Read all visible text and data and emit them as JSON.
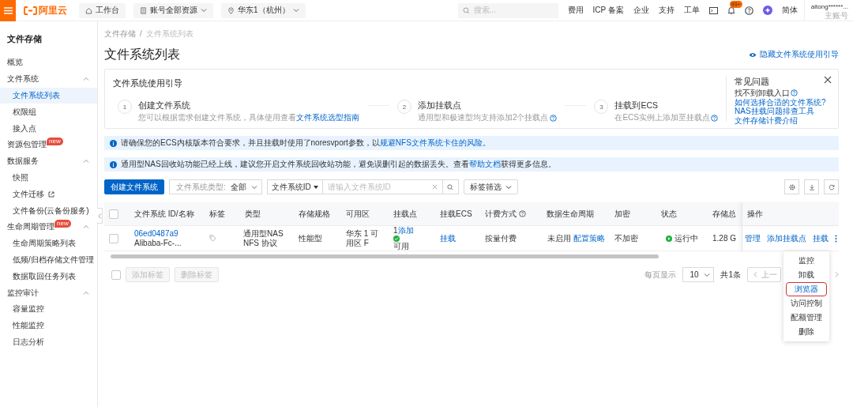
{
  "topbar": {
    "logo": "阿里云",
    "nav": [
      {
        "label": "工作台",
        "kind": "home"
      },
      {
        "label": "账号全部资源",
        "kind": "resource"
      },
      {
        "label": "华东1（杭州）",
        "kind": "region"
      }
    ],
    "search": {
      "placeholder": "搜索..."
    },
    "links": [
      "费用",
      "ICP 备案",
      "企业",
      "支持",
      "工单"
    ],
    "notification_badge": "99+",
    "language": "简体",
    "user": {
      "name": "aitong******...",
      "role": "主账号"
    }
  },
  "sidebar": {
    "title": "文件存储",
    "items": [
      {
        "label": "概览",
        "selected": false
      },
      {
        "label": "文件系统",
        "selected": false,
        "expanded": true,
        "children": [
          {
            "label": "文件系统列表",
            "selected": true
          },
          {
            "label": "权限组",
            "selected": false
          },
          {
            "label": "接入点",
            "selected": false
          }
        ]
      },
      {
        "label": "资源包管理",
        "badge": "new",
        "selected": false
      },
      {
        "label": "数据服务",
        "selected": false,
        "expanded": true,
        "children": [
          {
            "label": "快照",
            "selected": false,
            "external": false
          },
          {
            "label": "文件迁移",
            "selected": false,
            "external": true
          },
          {
            "label": "文件备份(云备份服务)",
            "selected": false,
            "external": false
          }
        ]
      },
      {
        "label": "生命周期管理",
        "badge": "new",
        "selected": false,
        "expanded": true,
        "children": [
          {
            "label": "生命周期策略列表",
            "selected": false
          },
          {
            "label": "低频/归档存储文件管理",
            "selected": false
          },
          {
            "label": "数据取回任务列表",
            "selected": false
          }
        ]
      },
      {
        "label": "监控审计",
        "selected": false,
        "expanded": true,
        "children": [
          {
            "label": "容量监控",
            "selected": false
          },
          {
            "label": "性能监控",
            "selected": false
          },
          {
            "label": "日志分析",
            "selected": false
          }
        ]
      }
    ]
  },
  "page": {
    "breadcrumb": [
      "文件存储",
      "文件系统列表"
    ],
    "breadcrumb_separator": "/",
    "title": "文件系统列表",
    "guide_toggle": "隐藏文件系统使用引导"
  },
  "guide": {
    "title": "文件系统使用引导",
    "steps": [
      {
        "number": "1",
        "title": "创建文件系统",
        "desc": "您可以根据需求创建文件系统，具体使用查看",
        "link": "文件系统选型指南",
        "help": false
      },
      {
        "number": "2",
        "title": "添加挂载点",
        "desc": "通用型和极速型均支持添加2个挂载点",
        "help": true
      },
      {
        "number": "3",
        "title": "挂载到ECS",
        "desc": "在ECS实例上添加至挂载点",
        "help": true
      }
    ],
    "faq": {
      "title": "常见问题",
      "items": [
        {
          "kind": "help",
          "text": "找不到卸载入口"
        },
        {
          "kind": "link",
          "text": "如何选择合适的文件系统?"
        },
        {
          "kind": "link",
          "text": "NAS挂载问题排查工具"
        },
        {
          "kind": "link",
          "text": "文件存储计费介绍"
        }
      ]
    }
  },
  "alerts": [
    {
      "text": "请确保您的ECS内核版本符合要求，并且挂载时使用了noresvport参数，以",
      "link": "规避NFS文件系统卡住的风险",
      "after": "。"
    },
    {
      "text": "通用型NAS回收站功能已经上线，建议您开启文件系统回收站功能，避免误删引起的数据丢失。查看",
      "link": "帮助文档",
      "after": "获得更多信息。"
    }
  ],
  "toolbar": {
    "create_button": "创建文件系统",
    "type_filter": {
      "label": "文件系统类型:",
      "value": "全部"
    },
    "search": {
      "field": "文件系统ID",
      "placeholder": "请输入文件系统ID"
    },
    "tag_filter": "标签筛选"
  },
  "table": {
    "header_checked": false,
    "columns": [
      {
        "label": "文件系统 ID/名称",
        "help": false
      },
      {
        "label": "标签",
        "help": false
      },
      {
        "label": "类型",
        "help": false
      },
      {
        "label": "存储规格",
        "help": false
      },
      {
        "label": "可用区",
        "help": false
      },
      {
        "label": "挂载点",
        "help": false
      },
      {
        "label": "挂载ECS",
        "help": false
      },
      {
        "label": "计费方式",
        "help": true
      },
      {
        "label": "数据生命周期",
        "help": false
      },
      {
        "label": "加密",
        "help": false
      },
      {
        "label": "状态",
        "help": false
      },
      {
        "label": "存储总",
        "help": false
      },
      {
        "label": "操作",
        "help": false
      }
    ],
    "rows": [
      {
        "checked": false,
        "id": "06ed0487a9",
        "name": "Alibaba-Fc-...",
        "type": "通用型NAS NFS 协议",
        "spec": "性能型",
        "zone": "华东 1 可用区 F",
        "mount": {
          "count": "1",
          "link": "添加",
          "status": "可用"
        },
        "ecs_link": "挂载",
        "billing": "按量付费",
        "lifecycle": {
          "text": "未启用",
          "link": "配置策略"
        },
        "encryption": "不加密",
        "status": "运行中",
        "storage": "1.28 G",
        "actions": [
          "管理",
          "添加挂载点",
          "挂载"
        ]
      }
    ]
  },
  "footer": {
    "checked": false,
    "buttons": [
      {
        "label": "添加标签",
        "disabled": true
      },
      {
        "label": "删除标签",
        "disabled": true
      }
    ],
    "page_size_label": "每页显示",
    "page_size": "10",
    "total": "共1条",
    "prev": "上一"
  },
  "menu": [
    {
      "label": "监控",
      "selected": false
    },
    {
      "label": "卸载",
      "selected": false
    },
    {
      "label": "浏览器",
      "selected": true
    },
    {
      "label": "访问控制",
      "selected": false
    },
    {
      "label": "配额管理",
      "selected": false
    },
    {
      "label": "删除",
      "selected": false
    }
  ]
}
